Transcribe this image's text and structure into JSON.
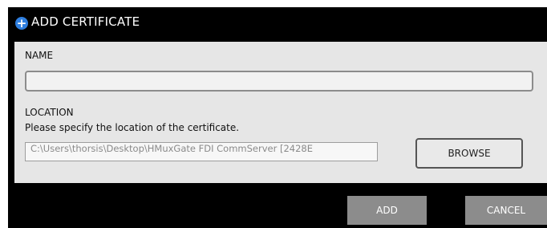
{
  "dialog": {
    "title": "ADD CERTIFICATE",
    "title_icon": "plus-circle-icon",
    "accent_color": "#2f7fe0"
  },
  "name_section": {
    "label": "NAME",
    "value": "",
    "placeholder": ""
  },
  "location_section": {
    "label": "LOCATION",
    "description": "Please specify the location of the certificate.",
    "path_value": "C:\\Users\\thorsis\\Desktop\\HMuxGate FDI CommServer [2428E",
    "browse_label": "BROWSE"
  },
  "footer": {
    "add_label": "ADD",
    "cancel_label": "CANCEL"
  }
}
